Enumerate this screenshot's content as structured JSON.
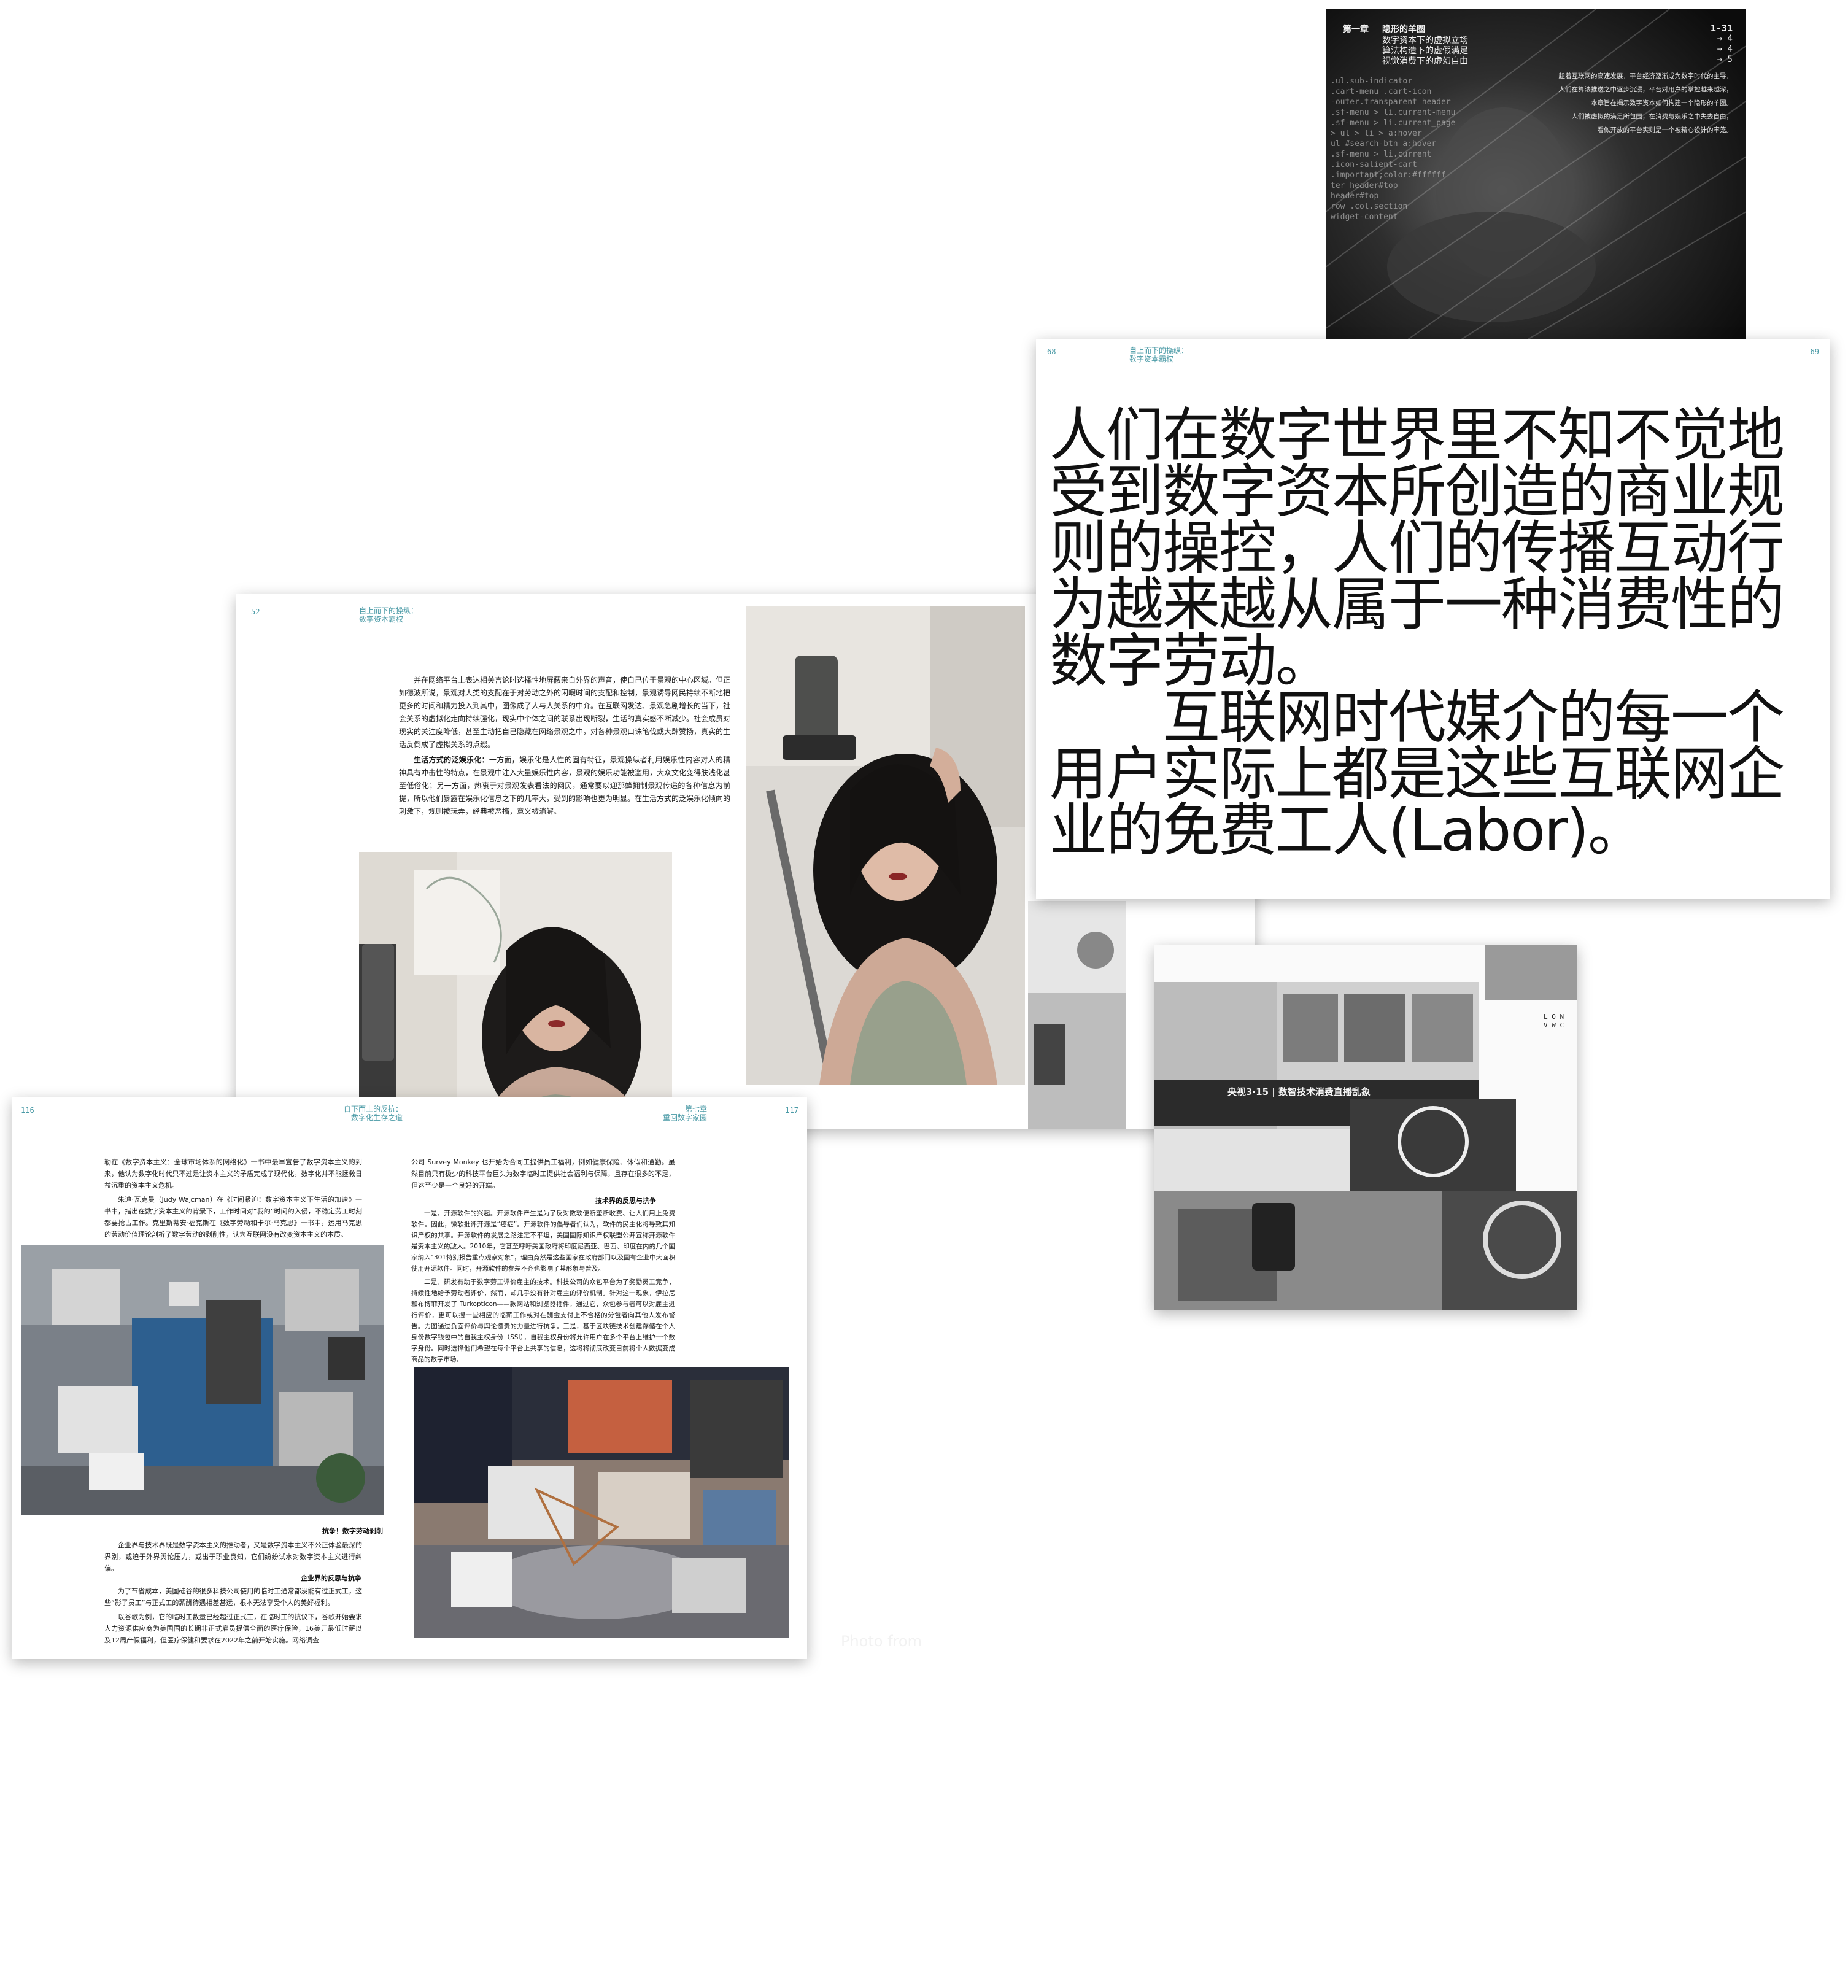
{
  "cover": {
    "chapter_label": "第一章",
    "chapter_title": "隐形的羊圈",
    "toc_lines": [
      "数字资本下的虚拟立场",
      "算法构造下的虚假满足",
      "视觉消费下的虚幻自由"
    ],
    "range": "1-31",
    "toc_pages": [
      "→ 4",
      "→ 4",
      "→ 5"
    ],
    "text_lines": [
      "趁着互联网的高速发展，平台经济逐渐成为数字时代的主导，",
      "人们在算法推送之中逐步沉浸，平台对用户的掌控越来越深，",
      "本章旨在揭示数字资本如何构建一个隐形的羊圈。",
      "人们被虚拟的满足所包围，在消费与娱乐之中失去自由，",
      "看似开放的平台实则是一个被精心设计的牢笼。"
    ],
    "code_lines": [
      ".ul.sub-indicator",
      ".cart-menu .cart-icon",
      "-outer.transparent header",
      ".sf-menu > li.current-menu",
      ".sf-menu > li.current_page",
      "> ul > li > a:hover",
      "ul #search-btn a:hover",
      ".sf-menu > li.current",
      ".icon-salient-cart",
      ".important;color:#ffffff",
      "ter header#top",
      "header#top",
      "row .col.section",
      "widget-content"
    ]
  },
  "quote_page": {
    "page_left": "68",
    "page_right": "69",
    "runhead": [
      "自上而下的操纵：",
      "数字资本霸权"
    ],
    "paragraph1": "人们在数字世界里不知不觉地受到数字资本所创造的商业规则的操控，人们的传播互动行为越来越从属于一种消费性的数字劳动。",
    "paragraph2": "互联网时代媒介的每一个用户实际上都是这些互联网企业的免费工人(Labor)。",
    "lines1": [
      "人们在数字世界里不知不觉地",
      "受到数字资本所创造的商业规",
      "则的操控，人们的传播互动行",
      "为越来越从属于一种消费性的",
      "数字劳动。"
    ],
    "lines2": [
      "　　互联网时代媒介的每一个",
      "用户实际上都是这些互联网企",
      "业的免费工人(Labor)。"
    ]
  },
  "mid_spread": {
    "page_left": "52",
    "runhead": [
      "自上而下的操纵：",
      "数字资本霸权"
    ],
    "paragraphs": [
      "并在网络平台上表达相关言论时选择性地屏蔽来自外界的声音，使自己位于景观的中心区域。但正如德波所说，景观对人类的支配在于对劳动之外的闲暇时间的支配和控制，景观诱导网民持续不断地把更多的时间和精力投入到其中，图像成了人与人关系的中介。在互联网发达、景观急剧增长的当下，社会关系的虚拟化走向持续强化，现实中个体之间的联系出现断裂，生活的真实感不断减少。社会成员对现实的关注度降低，甚至主动把自己隐藏在网络景观之中，对各种景观口诛笔伐或大肆赞扬，真实的生活反倒成了虚拟关系的点缀。",
      "生活方式的泛娱乐化：一方面，娱乐化是人性的固有特征，景观操纵者利用娱乐性内容对人的精神具有冲击性的特点，在景观中注入大量娱乐性内容，景观的娱乐功能被滥用，大众文化变得肤浅化甚至低俗化；另一方面，热衷于对景观发表看法的网民，通常要以迎那蜂拥制景观传递的各种信息为前提，所以他们暴露在娱乐化信息之下的几率大，受到的影响也更为明显。在生活方式的泛娱乐化倾向的刺激下，规则被玩弄，经典被恶搞，意义被消解。"
    ],
    "bold_lead": "生活方式的泛娱乐化："
  },
  "front_spread": {
    "page_left": "116",
    "page_right": "117",
    "runhead_left": [
      "自下而上的反抗：",
      "数字化生存之道"
    ],
    "runhead_right": [
      "第七章",
      "重回数字家园"
    ],
    "left_paragraphs": [
      "勒在《数字资本主义：全球市场体系的网络化》一书中最早宣告了数字资本主义的到来，他认为数字化时代只不过是让资本主义的矛盾完成了现代化，数字化并不能拯救日益沉重的资本主义危机。",
      "朱迪·瓦克曼（Judy Wajcman）在《时间紧迫：数字资本主义下生活的加速》一书中，指出在数字资本主义的背景下，工作时间对“我的”时间的入侵，不稳定劳工时刻都要抢占工作。克里斯蒂安·福克斯在《数字劳动和卡尔·马克思》一书中，运用马克思的劳动价值理论剖析了数字劳动的剥削性，认为互联网没有改变资本主义的本质。"
    ],
    "caption1": "抗争！数字劳动剥削",
    "left_paragraphs2": [
      "企业界与技术界既是数字资本主义的推动者，又是数字资本主义不公正体验最深的界别，或迫于外界舆论压力，或出于职业良知，它们纷纷试水对数字资本主义进行纠偏。"
    ],
    "caption2": "企业界的反思与抗争",
    "left_paragraphs3": [
      "为了节省成本，美国硅谷的很多科技公司使用的临时工通常都没能有过正式工，这些“影子员工”与正式工的薪酬待遇相差甚远，根本无法享受个人的美好福利。",
      "以谷歌为例，它的临时工数量已经超过正式工，在临时工的抗议下，谷歌开始要求人力资源供应商为美国国的长期非正式雇员提供全面的医疗保险，16美元最低时薪以及12周产假福利，但医疗保健和要求在2022年之前开始实施。网络调查"
    ],
    "right_paragraphs": [
      "公司 Survey Monkey 也开始为合同工提供员工福利，例如健康保险、休假和通勤。虽然目前只有极少的科技平台巨头为数字临时工提供社会福利与保障，且存在很多的不足，但这至少是一个良好的开端。"
    ],
    "caption3": "技术界的反思与抗争",
    "right_paragraphs2": [
      "一是，开源软件的兴起。开源软件产生是为了反对数软便断垄断收费、让人们用上免费软件。因此，微软批评开源是“癌症”。开源软件的倡导者们认为，软件的民主化将导致其知识产权的共享。开源软件的发展之路注定不平坦，美国国际知识产权联盟公开宣称开源软件是资本主义的敌人。2010年，它甚至呼吁美国政府将印度尼西亚、巴西、印度在内的几个国家纳入“301特别报告重点观察对象”，理由竟然是这些国家在政府部门以及国有企业中大面积使用开源软件。同时，开源软件的参差不齐也影响了其形象与普及。",
      "二是，研发有助于数字劳工评价雇主的技术。科技公司的众包平台为了奖励员工竞争，持续性地给予劳动者评价，然而，却几乎没有针对雇主的评价机制。针对这一现象，伊拉尼和布博菲开发了 Turkopticon——款网站和浏览器插件，通过它，众包参与者可以对雇主进行评价，更可以搜一些相应的临薪工作或对在酬金支付上不合格的分包者向其他人发布警告。力图通过负面评价与舆论谴责的力量进行抗争。三是，基于区块链技术创建存储在个人身份数字钱包中的自我主权身份（SSI），自我主权身份将允许用户在多个平台上维护一个数字身份。同时选择他们希望在每个平台上共享的信息，这将将彻底改变目前将个人数据变成商品的数字市场。"
    ],
    "bold_leads": [
      "一是，开源软件的兴起。",
      "二是，研发有助于数字劳工评价雇主的技术。"
    ]
  },
  "collage_sheet": {
    "side_text": [
      "L",
      "O",
      "N",
      "V",
      "W",
      "C"
    ],
    "banner": "央视3·15 | 数智技术消费直播乱象"
  },
  "watermark": "Photo from"
}
